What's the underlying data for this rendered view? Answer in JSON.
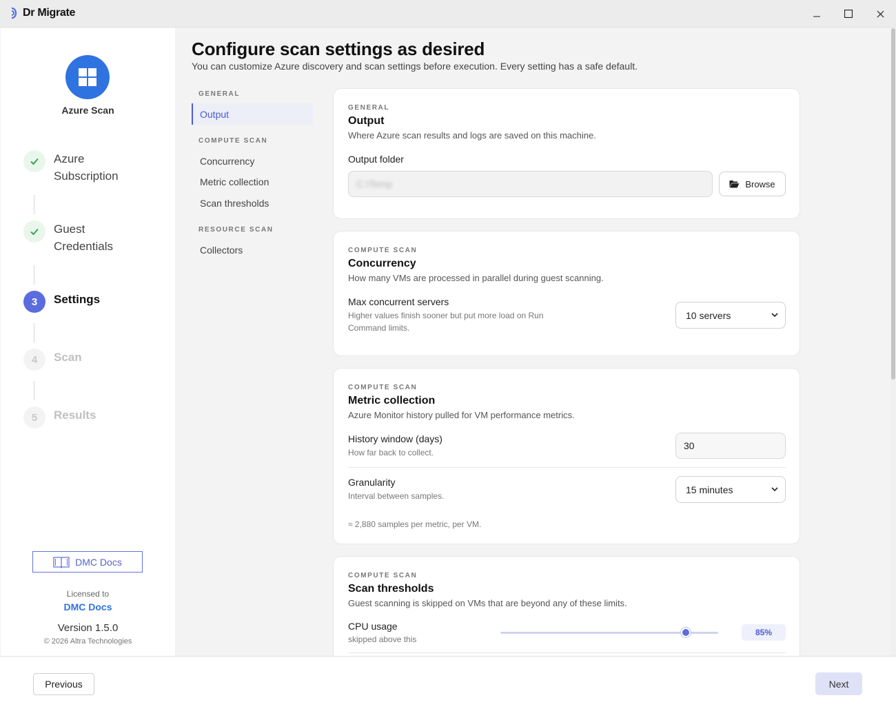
{
  "app": {
    "name": "Dr Migrate"
  },
  "window_controls": {
    "minimize_icon": "minimize-icon",
    "maximize_icon": "maximize-icon",
    "close_icon": "close-icon"
  },
  "rail": {
    "title": "Azure Scan",
    "steps": [
      {
        "label_line1": "Azure",
        "label_line2": "Subscription",
        "state": "done"
      },
      {
        "label_line1": "Guest",
        "label_line2": "Credentials",
        "state": "done"
      },
      {
        "number": "3",
        "label": "Settings",
        "state": "active"
      },
      {
        "number": "4",
        "label": "Scan",
        "state": "pending"
      },
      {
        "number": "5",
        "label": "Results",
        "state": "pending"
      }
    ],
    "docs_button": "DMC Docs",
    "licensed_to_label": "Licensed to",
    "licensee": "DMC Docs",
    "version": "Version 1.5.0",
    "copyright": "© 2026 Altra Technologies"
  },
  "page": {
    "title": "Configure scan settings as desired",
    "subtitle": "You can customize Azure discovery and scan settings before execution. Every setting has a safe default."
  },
  "section_nav": {
    "groups": [
      {
        "label": "GENERAL",
        "items": [
          "Output"
        ]
      },
      {
        "label": "COMPUTE SCAN",
        "items": [
          "Concurrency",
          "Metric collection",
          "Scan thresholds"
        ]
      },
      {
        "label": "RESOURCE SCAN",
        "items": [
          "Collectors"
        ]
      }
    ],
    "active": "Output"
  },
  "cards": {
    "output": {
      "kicker": "GENERAL",
      "title": "Output",
      "desc": "Where Azure scan results and logs are saved on this machine.",
      "field_label": "Output folder",
      "folder_value": "C:\\Temp",
      "browse_label": "Browse"
    },
    "concurrency": {
      "kicker": "COMPUTE SCAN",
      "title": "Concurrency",
      "desc": "How many VMs are processed in parallel during guest scanning.",
      "field_label": "Max concurrent servers",
      "field_help": "Higher values finish sooner but put more load on Run Command limits.",
      "selected": "10 servers"
    },
    "metrics": {
      "kicker": "COMPUTE SCAN",
      "title": "Metric collection",
      "desc": "Azure Monitor history pulled for VM performance metrics.",
      "history_label": "History window (days)",
      "history_help": "How far back to collect.",
      "history_value": "30",
      "granularity_label": "Granularity",
      "granularity_help": "Interval between samples.",
      "granularity_selected": "15 minutes",
      "note": "≈ 2,880 samples per metric, per VM."
    },
    "thresholds": {
      "kicker": "COMPUTE SCAN",
      "title": "Scan thresholds",
      "desc": "Guest scanning is skipped on VMs that are beyond any of these limits.",
      "cpu_label": "CPU usage",
      "cpu_help": "skipped above this",
      "cpu_value_text": "85%",
      "cpu_value": 0.85
    }
  },
  "footer": {
    "previous": "Previous",
    "next": "Next"
  },
  "colors": {
    "accent": "#5b6cdf",
    "brand_blue": "#2f73e0",
    "success": "#3aa655"
  }
}
